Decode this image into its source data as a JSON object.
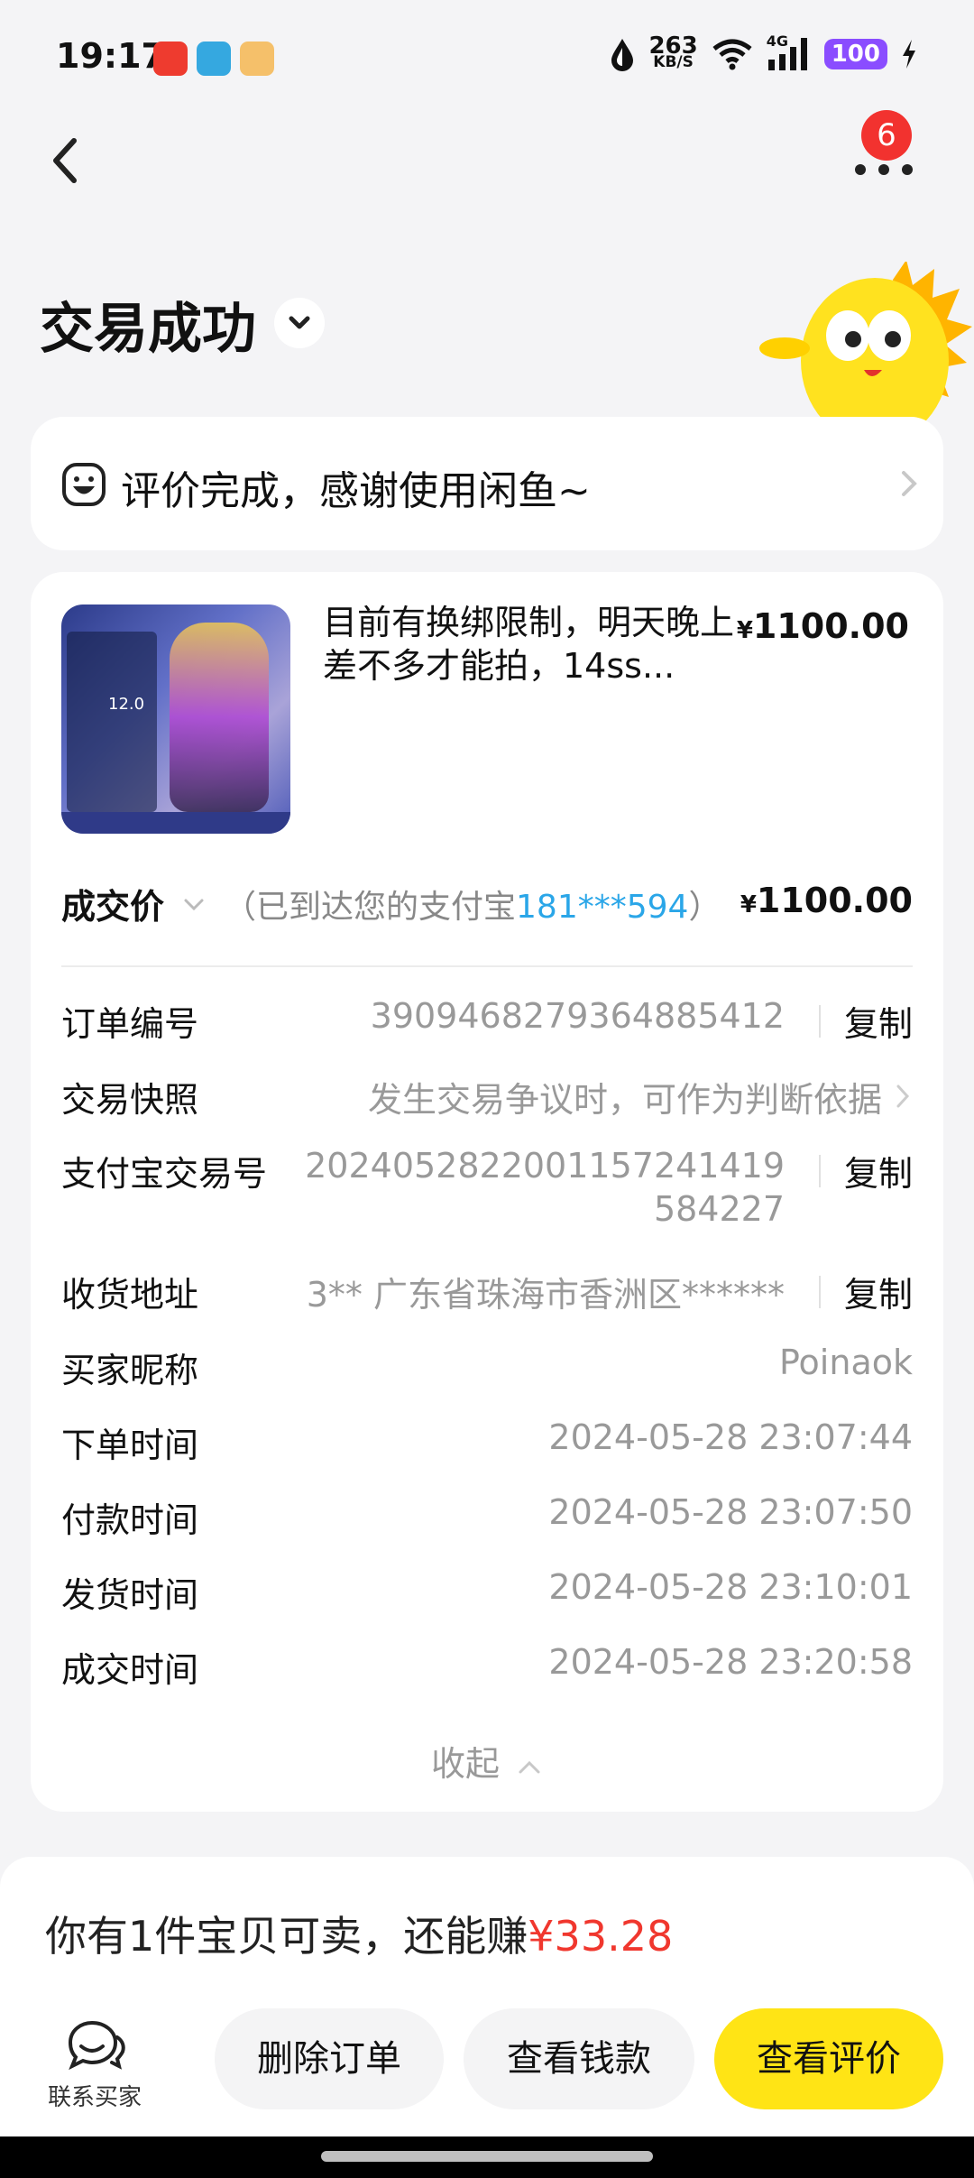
{
  "status_bar": {
    "time": "19:17",
    "net_speed_value": "263",
    "net_speed_unit": "KB/S",
    "network": "4G",
    "battery": "100",
    "icons": [
      "youtube-icon",
      "telegram-icon",
      "game-icon",
      "water-drop-icon",
      "wifi-icon",
      "signal-icon",
      "charging-icon"
    ]
  },
  "header": {
    "more_badge": "6",
    "title": "交易成功"
  },
  "review": {
    "text": "评价完成，感谢使用闲鱼~"
  },
  "product": {
    "title": "目前有换绑限制，明天晚上差不多才能拍，14ss...",
    "currency": "¥",
    "price": "1100.00",
    "thumb_label": "12.0"
  },
  "deal": {
    "label": "成交价",
    "note_prefix": "（已到达您的支付宝",
    "account": "181***594",
    "note_suffix": "）",
    "currency": "¥",
    "price": "1100.00"
  },
  "details": {
    "order_no_label": "订单编号",
    "order_no": "3909468279364885412",
    "snapshot_label": "交易快照",
    "snapshot_value": "发生交易争议时，可作为判断依据",
    "alipay_label": "支付宝交易号",
    "alipay_line1": "202405282200115724141​9",
    "alipay_line2": "584227",
    "address_label": "收货地址",
    "address_value": "3** 广东省珠海市香洲区******",
    "buyer_label": "买家昵称",
    "buyer_value": "Poinaok",
    "order_time_label": "下单时间",
    "order_time": "2024-05-28 23:07:44",
    "pay_time_label": "付款时间",
    "pay_time": "2024-05-28 23:07:50",
    "ship_time_label": "发货时间",
    "ship_time": "2024-05-28 23:10:01",
    "deal_time_label": "成交时间",
    "deal_time": "2024-05-28 23:20:58",
    "copy": "复制",
    "collapse": "收起"
  },
  "bottom": {
    "earn_prefix": "你有1件宝贝可卖，还能赚",
    "earn_amount": "¥33.28",
    "contact_label": "联系买家",
    "delete_label": "删除订单",
    "money_label": "查看钱款",
    "review_label": "查看评价"
  },
  "colors": {
    "accent_yellow": "#ffe415",
    "price_red": "#f0372e",
    "link_blue": "#2aa6e8",
    "badge_red": "#f2322f"
  }
}
